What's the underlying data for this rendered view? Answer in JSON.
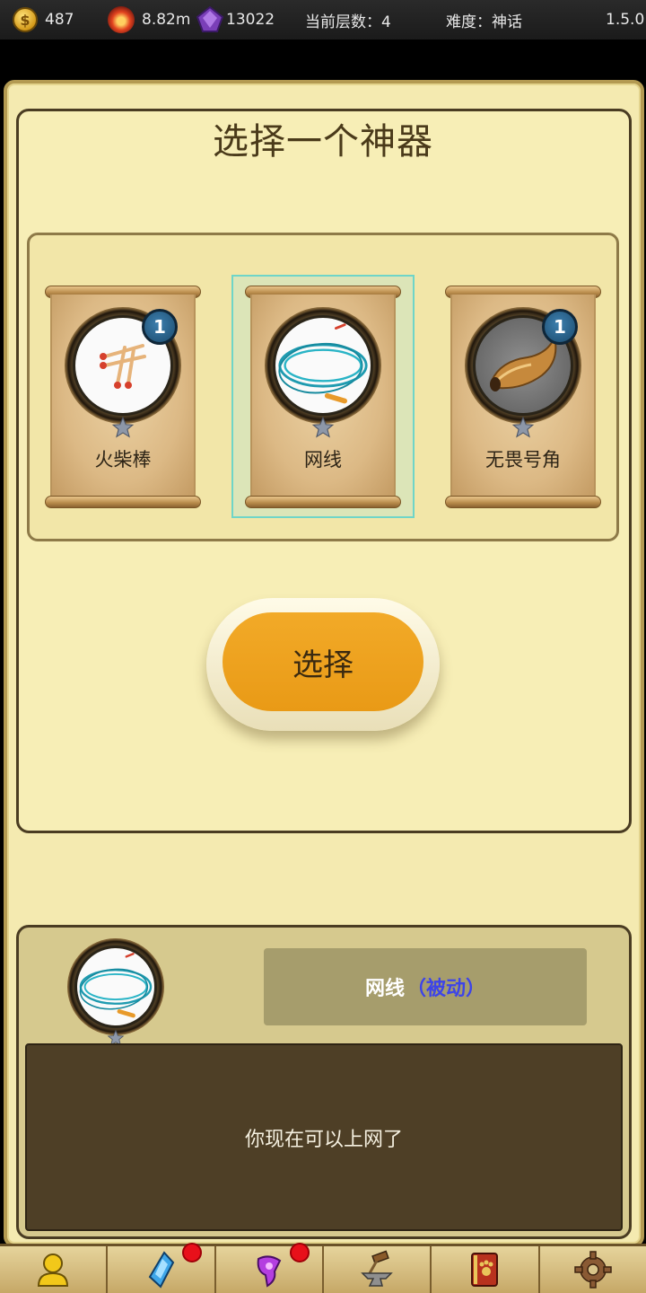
{
  "status_bar": {
    "gold": "487",
    "fire": "8.82m",
    "gems": "13022",
    "floor_label": "当前层数：4",
    "difficulty_label": "难度：神话",
    "version": "1.5.0"
  },
  "title": "选择一个神器",
  "cards": [
    {
      "name": "火柴棒",
      "level": "1",
      "icon": "matchsticks-icon"
    },
    {
      "name": "网线",
      "level": "",
      "icon": "net-cable-icon",
      "selected": true
    },
    {
      "name": "无畏号角",
      "level": "1",
      "icon": "horn-icon"
    }
  ],
  "select_button": "选择",
  "detail": {
    "name": "网线",
    "tag": "（被动）",
    "description": "你现在可以上网了"
  },
  "bottom_nav": [
    {
      "icon": "hero-icon",
      "badge": false
    },
    {
      "icon": "crystal-icon",
      "badge": true
    },
    {
      "icon": "purple-rune-icon",
      "badge": true
    },
    {
      "icon": "anvil-icon",
      "badge": false
    },
    {
      "icon": "pet-book-icon",
      "badge": false
    },
    {
      "icon": "gear-icon",
      "badge": false
    }
  ],
  "colors": {
    "parchment": "#f7eeb6",
    "button_orange": "#f2aa28",
    "selection_outline": "#6fd5c8",
    "passive_tag": "#3d44e8",
    "notification_dot": "#e8101a"
  }
}
